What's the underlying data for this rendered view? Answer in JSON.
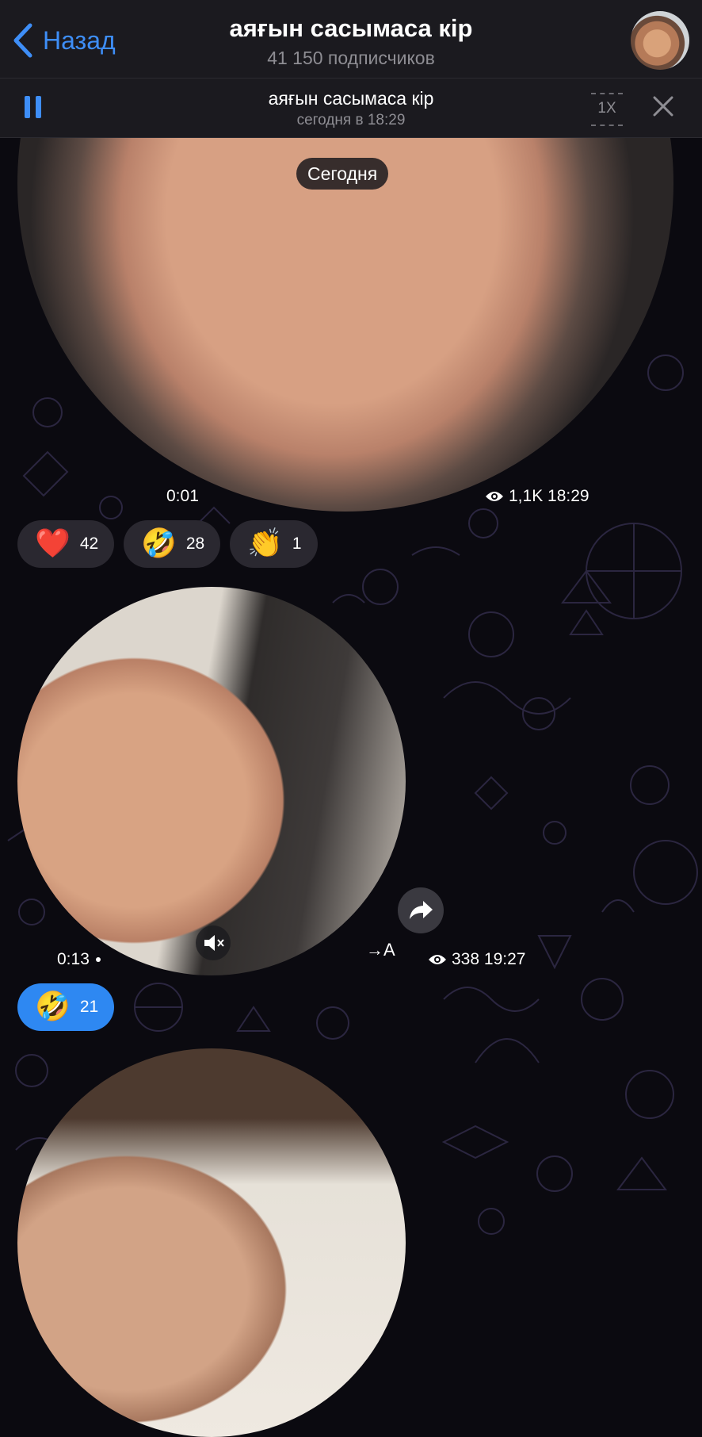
{
  "header": {
    "back_label": "Назад",
    "title": "аяғын сасымаса кір",
    "subscribers": "41 150 подписчиков"
  },
  "player": {
    "title": "аяғын сасымаса кір",
    "time": "сегодня в 18:29",
    "speed": "1X"
  },
  "date_separator": "Сегодня",
  "messages": [
    {
      "duration": "0:01",
      "views": "1,1K",
      "time": "18:29",
      "reactions": [
        {
          "emoji": "❤️",
          "count": "42"
        },
        {
          "emoji": "🤣",
          "count": "28"
        },
        {
          "emoji": "👏",
          "count": "1"
        }
      ]
    },
    {
      "duration": "0:13",
      "views": "338",
      "time": "19:27",
      "translate_label": "→A",
      "reactions": [
        {
          "emoji": "🤣",
          "count": "21"
        }
      ]
    }
  ],
  "colors": {
    "accent": "#3e8ef7",
    "header_bg": "#1b1a1f",
    "background": "#0b0a10",
    "reaction_bg": "#2a2830",
    "reaction_active": "#2e88f2"
  }
}
